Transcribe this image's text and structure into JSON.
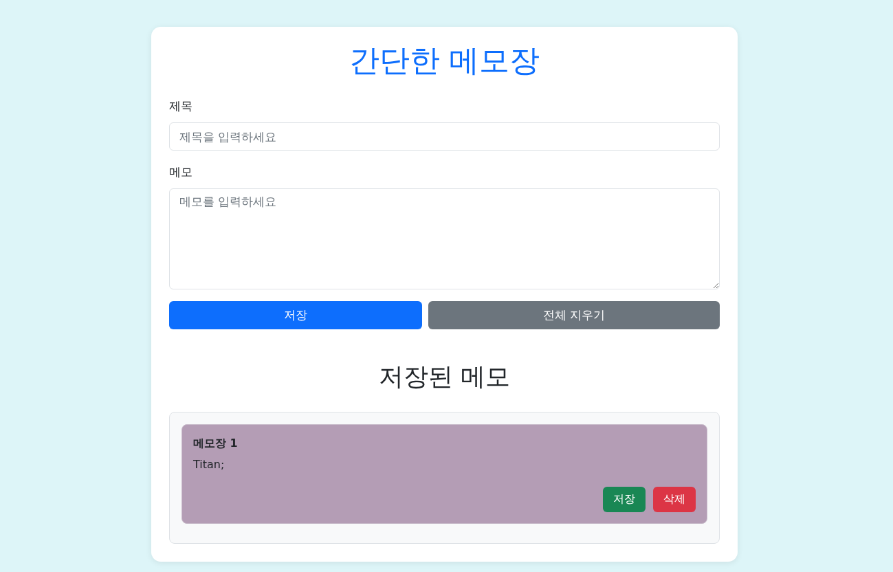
{
  "title": "간단한 메모장",
  "form": {
    "title_label": "제목",
    "title_field": {
      "placeholder": "제목을 입력하세요"
    },
    "memo_label": "메모",
    "memo_field": {
      "placeholder": "메모를 입력하세요"
    },
    "save_button": "저장",
    "clear_button": "전체 지우기"
  },
  "saved_heading": "저장된 메모",
  "memos": [
    {
      "title": "메모장 1",
      "body": "Titan;",
      "color": "#b49db5",
      "save_button": "저장",
      "delete_button": "삭제"
    }
  ]
}
